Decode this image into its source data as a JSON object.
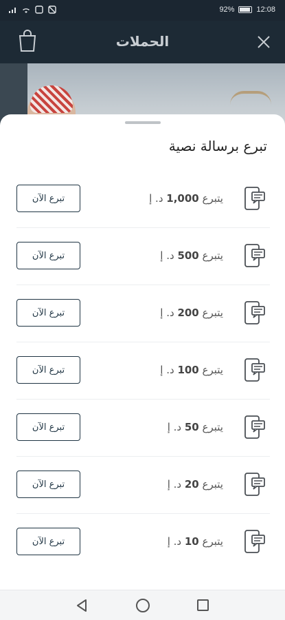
{
  "status_bar": {
    "battery": "92%",
    "time": "12:08"
  },
  "header": {
    "title": "الحملات"
  },
  "sheet": {
    "title": "تبرع برسالة نصية",
    "items": [
      {
        "prefix": "يتبرع",
        "amount": "1,000",
        "currency": "د. إ",
        "button": "تبرع الآن"
      },
      {
        "prefix": "يتبرع",
        "amount": "500",
        "currency": "د. إ",
        "button": "تبرع الآن"
      },
      {
        "prefix": "يتبرع",
        "amount": "200",
        "currency": "د. إ",
        "button": "تبرع الآن"
      },
      {
        "prefix": "يتبرع",
        "amount": "100",
        "currency": "د. إ",
        "button": "تبرع الآن"
      },
      {
        "prefix": "يتبرع",
        "amount": "50",
        "currency": "د. إ",
        "button": "تبرع الآن"
      },
      {
        "prefix": "يتبرع",
        "amount": "20",
        "currency": "د. إ",
        "button": "تبرع الآن"
      },
      {
        "prefix": "يتبرع",
        "amount": "10",
        "currency": "د. إ",
        "button": "تبرع الآن"
      }
    ]
  },
  "icons": {
    "close": "close-icon",
    "bag": "shopping-bag-icon",
    "sms": "sms-phone-icon"
  },
  "colors": {
    "header_bg": "#1d2a35",
    "button_border": "#1f3443"
  }
}
